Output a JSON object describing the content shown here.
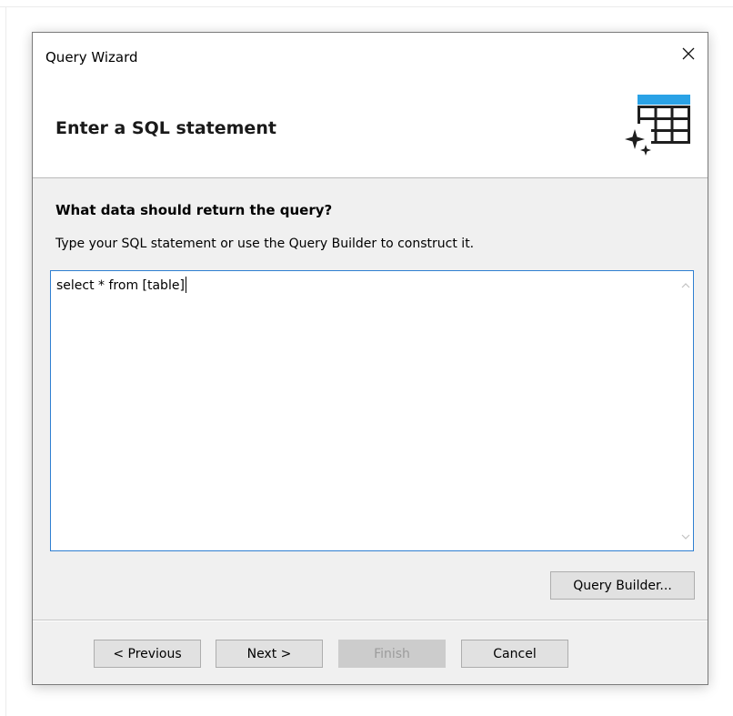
{
  "window": {
    "title": "Query Wizard"
  },
  "header": {
    "heading": "Enter a SQL statement",
    "icon": "table-sparkle-icon"
  },
  "body": {
    "question": "What data should return the query?",
    "instruction": "Type your SQL statement or use the Query Builder to construct it.",
    "sql_value": "select * from [table]",
    "query_builder_label": "Query Builder..."
  },
  "footer": {
    "previous_label": "< Previous",
    "next_label": "Next >",
    "finish_label": "Finish",
    "cancel_label": "Cancel"
  },
  "colors": {
    "accent_blue": "#2f7fd1",
    "icon_blue": "#2aa2e6",
    "icon_dark": "#1e1e1e"
  }
}
